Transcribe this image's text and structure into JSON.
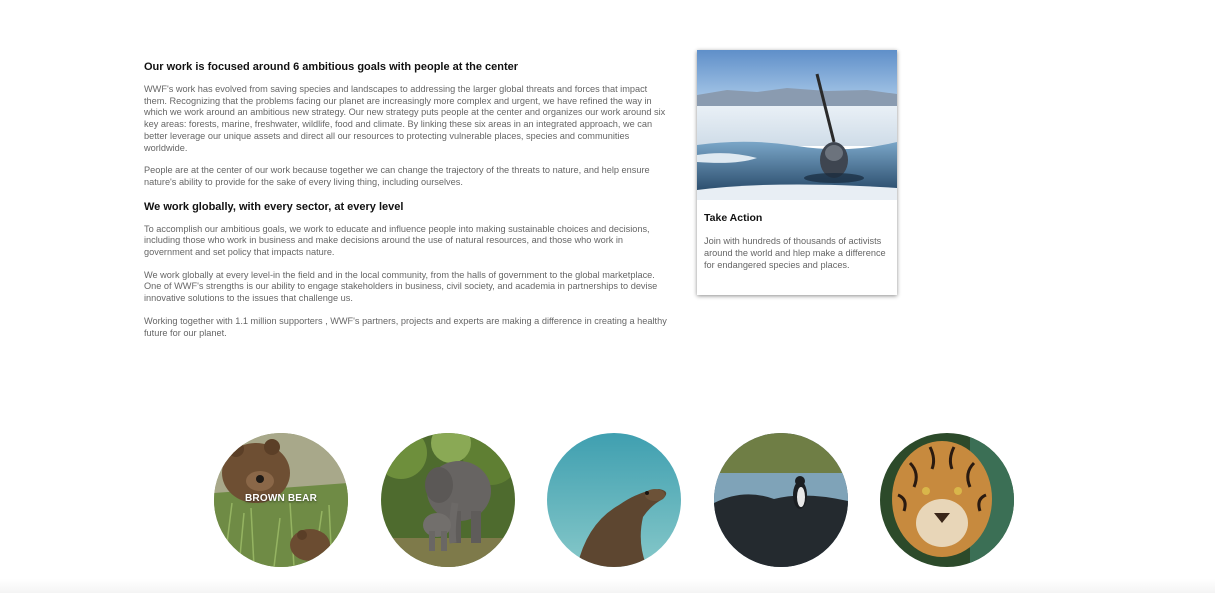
{
  "main": {
    "heading1": "Our work is focused around 6 ambitious goals with people at the center",
    "para1": "WWF's work has evolved from saving species and landscapes to addressing the larger global threats and forces that impact them. Recognizing that the problems facing our planet are increasingly more complex and urgent, we have refined the way in which we work around an ambitious new strategy. Our new strategy puts people at the center and organizes our work around six key areas: forests, marine, freshwater, wildlife, food and climate. By linking these six areas in an integrated approach, we can better leverage our unique assets and direct all our resources to protecting vulnerable places, species and communities worldwide.",
    "para2": "People are at the center of our work because together we can change the trajectory of the threats to nature, and help ensure nature's ability to provide for the sake of every living thing, including ourselves.",
    "heading2": "We work globally, with every sector, at every level",
    "para3": "To accomplish our ambitious goals, we work to educate and influence people into making sustainable choices and decisions, including those who work in business and make decisions around the use of natural resources, and those who work in government and set policy that impacts nature.",
    "para4": "We work globally at every level-in the field and in the local community, from the halls of government to the global marketplace. One of WWF's strengths is our ability to engage stakeholders in business, civil society, and academia in partnerships to devise innovative solutions to the issues that challenge us.",
    "para5": "Working together with 1.1 million supporters , WWF's partners, projects and experts are making a difference in creating a healthy future for our planet."
  },
  "card": {
    "title": "Take Action",
    "text": "Join with hundreds of thousands of activists around the world and hlep make a difference for endangered species and places."
  },
  "animals": [
    {
      "label": "BROWN BEAR"
    }
  ]
}
